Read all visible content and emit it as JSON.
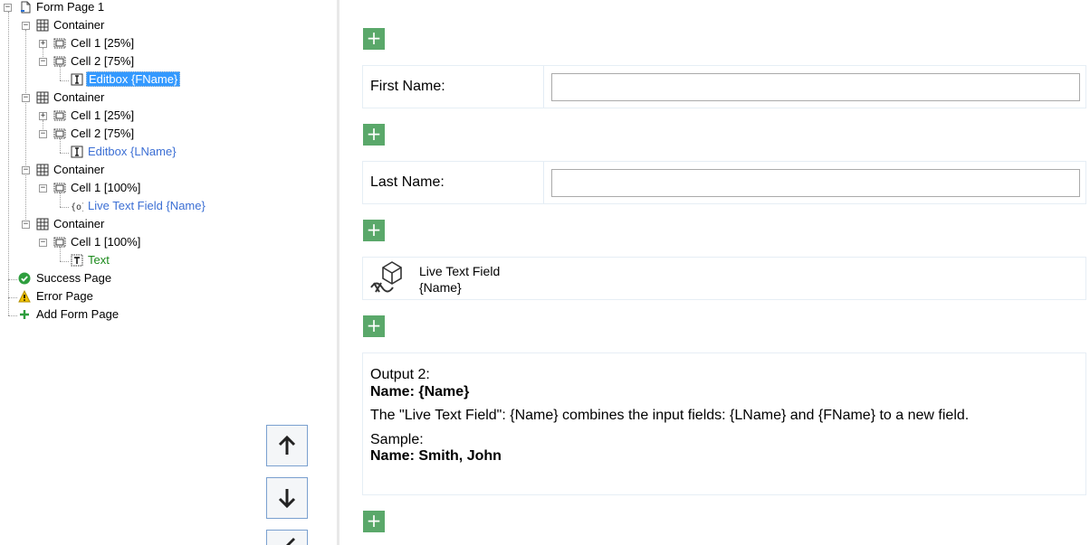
{
  "tree": {
    "root": "Form Page 1",
    "container1": {
      "label": "Container",
      "cell1": "Cell 1 [25%]",
      "cell2": "Cell 2 [75%]",
      "field": "Editbox {FName}"
    },
    "container2": {
      "label": "Container",
      "cell1": "Cell 1 [25%]",
      "cell2": "Cell 2 [75%]",
      "field": "Editbox {LName}"
    },
    "container3": {
      "label": "Container",
      "cell1": "Cell 1 [100%]",
      "field": "Live Text Field {Name}"
    },
    "container4": {
      "label": "Container",
      "cell1": "Cell 1 [100%]",
      "field": "Text"
    },
    "success_page": "Success Page",
    "error_page": "Error Page",
    "add_form_page": "Add Form Page"
  },
  "designer": {
    "plus_glyph": "+",
    "first_name_label": "First Name:",
    "first_name_value": "",
    "last_name_label": "Last Name:",
    "last_name_value": "",
    "live_text_field_line1": "Live Text Field",
    "live_text_field_line2": "{Name}",
    "text_block": {
      "output_label": "Output 2:",
      "name_line": "Name: {Name}",
      "description": "The \"Live Text Field\": {Name} combines the input fields: {LName} and {FName} to a new field.",
      "sample_label": "Sample:",
      "sample_line": "Name: Smith, John"
    }
  },
  "colors": {
    "selection": "#3399ff",
    "link": "#3c6fd4",
    "text_node": "#1b8a1b",
    "plus_button": "#5aa86a"
  }
}
